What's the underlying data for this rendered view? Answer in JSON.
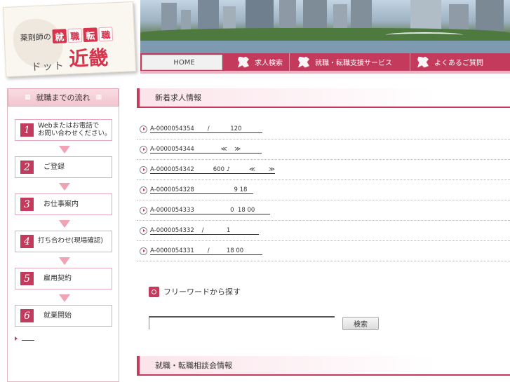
{
  "logo": {
    "prefix": "薬剤師の",
    "tiles": [
      "就",
      "職",
      "転",
      "職"
    ],
    "sub": "ドット",
    "name": "近畿"
  },
  "nav": {
    "items": [
      {
        "label": "HOME",
        "icon": "home"
      },
      {
        "label": "求人検索",
        "icon": "kinki-map-icon"
      },
      {
        "label": "就職・転職支援サービス",
        "icon": "kinki-map-icon"
      },
      {
        "label": "よくあるご質問",
        "icon": "kinki-map-icon"
      }
    ]
  },
  "sidebar": {
    "title": "就職までの流れ",
    "steps": [
      {
        "num": "1",
        "label": "Webまたはお電話で\nお問い合わせください。"
      },
      {
        "num": "2",
        "label": "ご登録"
      },
      {
        "num": "3",
        "label": "お仕事案内"
      },
      {
        "num": "4",
        "label": "打ち合わせ(現場確認)"
      },
      {
        "num": "5",
        "label": "雇用契約"
      },
      {
        "num": "6",
        "label": "就業開始"
      }
    ]
  },
  "main": {
    "new_jobs_title": "新着求人情報",
    "jobs": [
      "A-0000054354       /           120           ",
      "A-0000054344              ≪    ≫           ",
      "A-0000054342          600 ♪          ≪       ≫",
      "A-0000054328                     9 18   ",
      "A-0000054333                   0  18 00        ",
      "A-0000054332    /            1               ",
      "A-0000054331       /         18 00          "
    ],
    "search_title": "フリーワードから探す",
    "search_placeholder": "",
    "search_button": "検索",
    "consult_title": "就職・転職相談会情報"
  },
  "colors": {
    "accent": "#c43a5c",
    "accent_light": "#f9dce3"
  }
}
